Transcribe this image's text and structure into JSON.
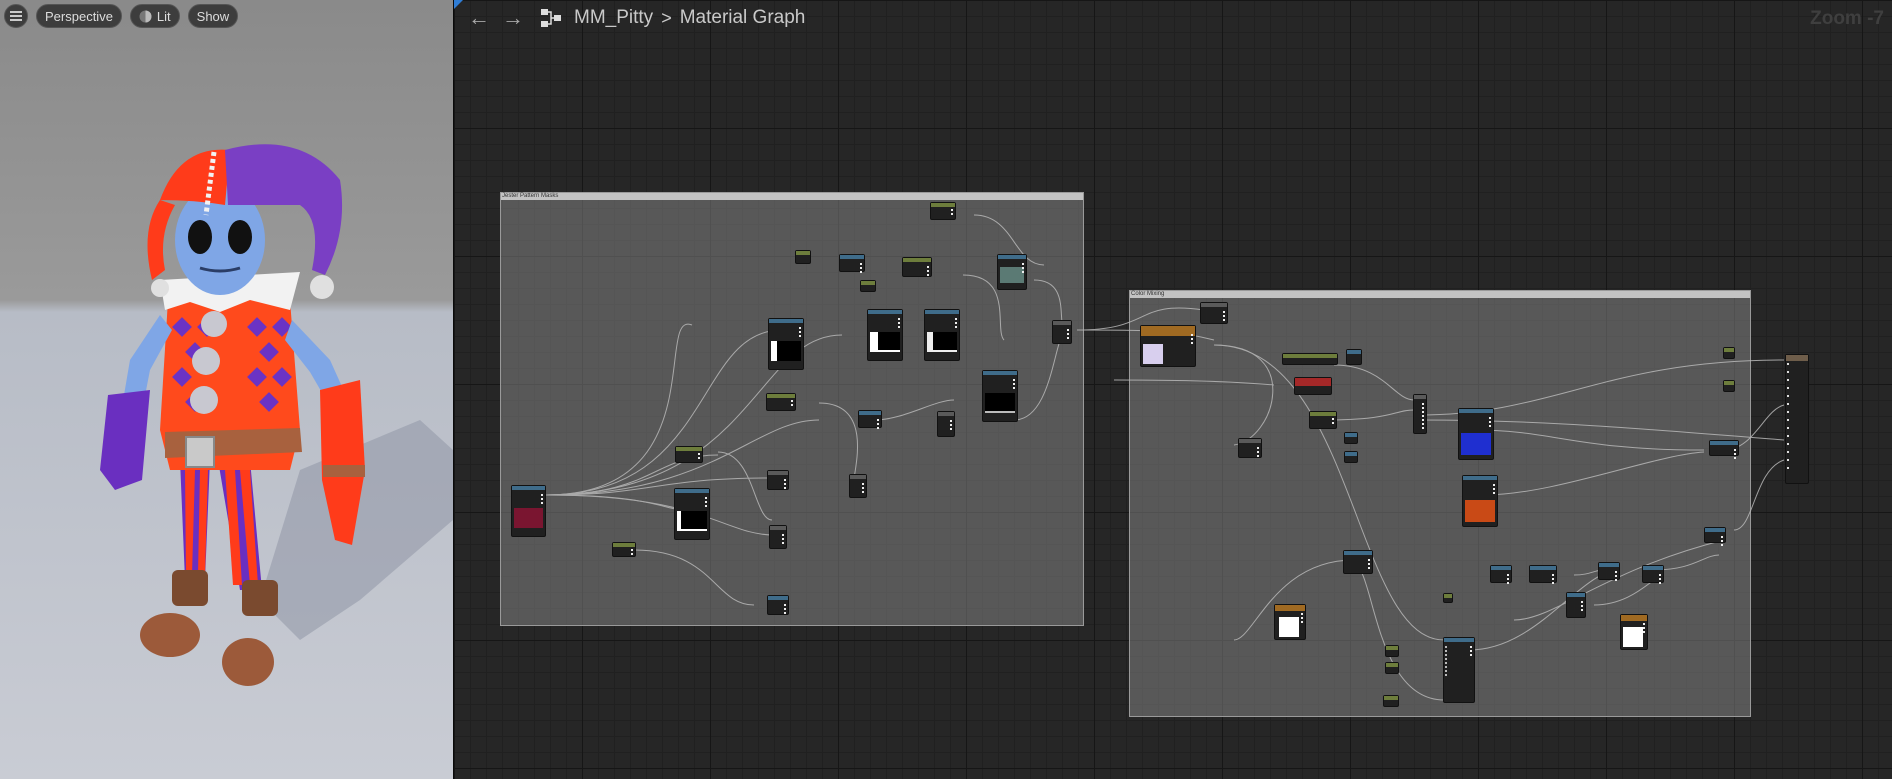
{
  "viewport": {
    "menu_icon": "hamburger-menu-icon",
    "perspective_label": "Perspective",
    "lit_label": "Lit",
    "show_label": "Show"
  },
  "graph": {
    "breadcrumb": {
      "asset": "MM_Pitty",
      "separator": ">",
      "graph": "Material Graph"
    },
    "zoom_label": "Zoom -7",
    "comments": [
      {
        "title": "Jester Pattern Masks"
      },
      {
        "title": "Color Mixing"
      }
    ]
  },
  "colors": {
    "graph_bg": "#262626",
    "comment_fill": "#828282",
    "node_header_blue": "#3f6c8a",
    "node_header_green": "#6d7d3c",
    "node_header_orange": "#a06a22",
    "node_header_red": "#a52828",
    "node_header_gray": "#5a5a5a",
    "jester_purple": "#7a3fc4",
    "jester_orange": "#ff4a1c",
    "jester_skin": "#7fa6e6"
  }
}
